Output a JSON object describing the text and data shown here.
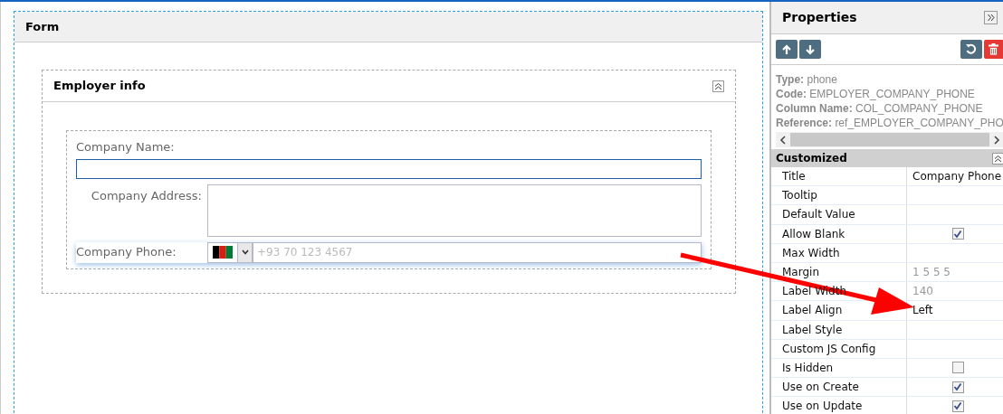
{
  "form": {
    "title": "Form"
  },
  "section": {
    "title": "Employer info",
    "fields": [
      {
        "kind": "text",
        "label": "Company Name:",
        "focused": true
      },
      {
        "kind": "textarea",
        "label": "Company Address:",
        "focused": false
      },
      {
        "kind": "phone",
        "label": "Company Phone:",
        "placeholder": "+93 70 123 4567",
        "focused": false
      }
    ]
  },
  "properties": {
    "title": "Properties",
    "info": [
      {
        "key": "Type:",
        "value": "phone"
      },
      {
        "key": "Code:",
        "value": "EMPLOYER_COMPANY_PHONE"
      },
      {
        "key": "Column Name:",
        "value": "COL_COMPANY_PHONE"
      },
      {
        "key": "Reference:",
        "value": "ref_EMPLOYER_COMPANY_PHO"
      }
    ],
    "group": "Customized",
    "rows": [
      {
        "name": "Title",
        "kind": "text",
        "value": "Company Phone",
        "muted": false
      },
      {
        "name": "Tooltip",
        "kind": "text"
      },
      {
        "name": "Default Value",
        "kind": "text"
      },
      {
        "name": "Allow Blank",
        "kind": "checkbox",
        "checked": true
      },
      {
        "name": "Max Width",
        "kind": "text"
      },
      {
        "name": "Margin",
        "kind": "text",
        "value": "1 5 5 5",
        "muted": true
      },
      {
        "name": "Label Width",
        "kind": "text",
        "value": "140",
        "muted": true
      },
      {
        "name": "Label Align",
        "kind": "text",
        "value": "Left",
        "muted": false
      },
      {
        "name": "Label Style",
        "kind": "text"
      },
      {
        "name": "Custom JS Config",
        "kind": "text"
      },
      {
        "name": "Is Hidden",
        "kind": "checkbox",
        "checked": false
      },
      {
        "name": "Use on Create",
        "kind": "checkbox",
        "checked": true
      },
      {
        "name": "Use on Update",
        "kind": "checkbox",
        "checked": true
      }
    ]
  }
}
